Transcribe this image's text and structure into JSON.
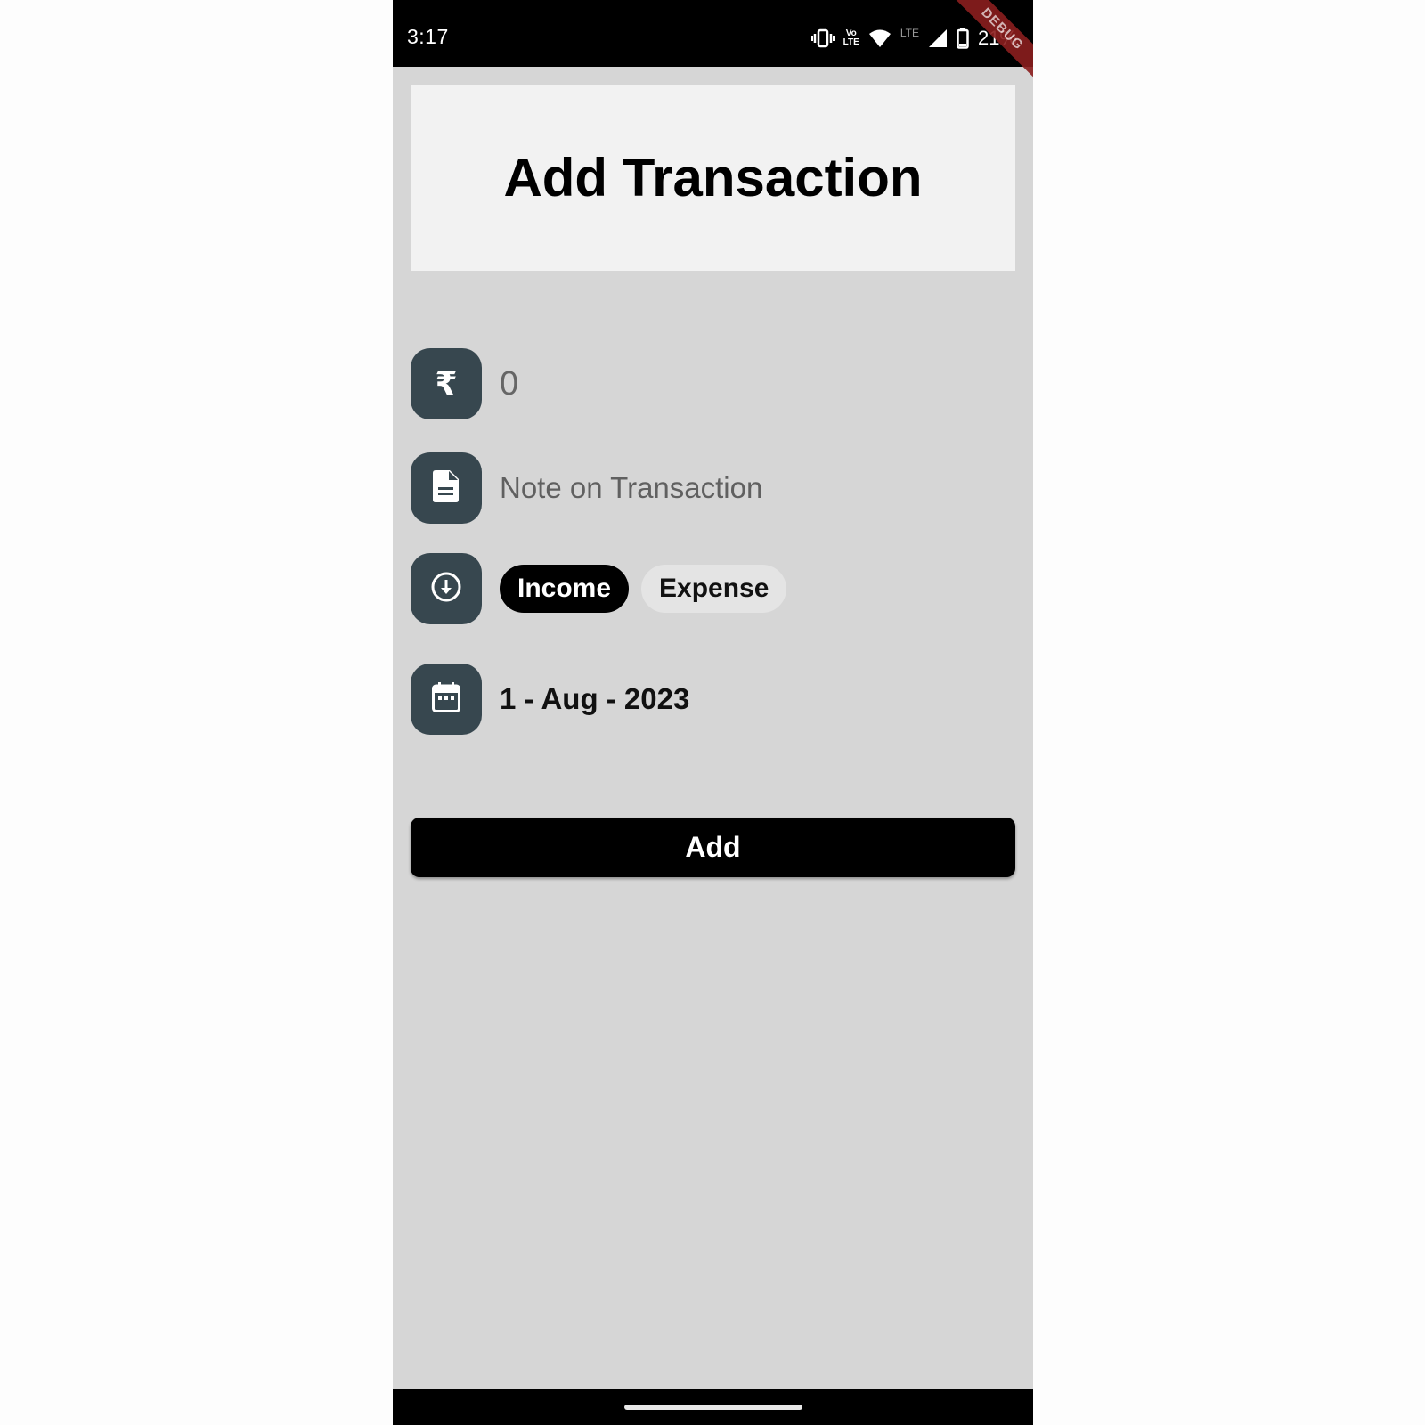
{
  "status_bar": {
    "time": "3:17",
    "network_label": "LTE",
    "volte_top": "Vo",
    "volte_bottom": "LTE",
    "battery": "21%",
    "debug_banner": "DEBUG",
    "icons": [
      "vibrate-icon",
      "volte-icon",
      "wifi-icon",
      "cell-signal-icon",
      "battery-icon"
    ]
  },
  "header": {
    "title": "Add Transaction"
  },
  "form": {
    "amount": {
      "icon": "rupee-icon",
      "placeholder": "0",
      "value": ""
    },
    "note": {
      "icon": "document-icon",
      "placeholder": "Note on Transaction",
      "value": ""
    },
    "type": {
      "icon": "download-circle-icon",
      "options": [
        "Income",
        "Expense"
      ],
      "selected": "Income"
    },
    "date": {
      "icon": "calendar-icon",
      "value": "1 - Aug - 2023"
    }
  },
  "actions": {
    "add_label": "Add"
  },
  "colors": {
    "background": "#d6d6d6",
    "card": "#f2f2f2",
    "icon_box": "#37474f",
    "primary": "#000000",
    "chip_unselected": "#e4e4e4",
    "debug_banner": "#8b1e1e"
  }
}
